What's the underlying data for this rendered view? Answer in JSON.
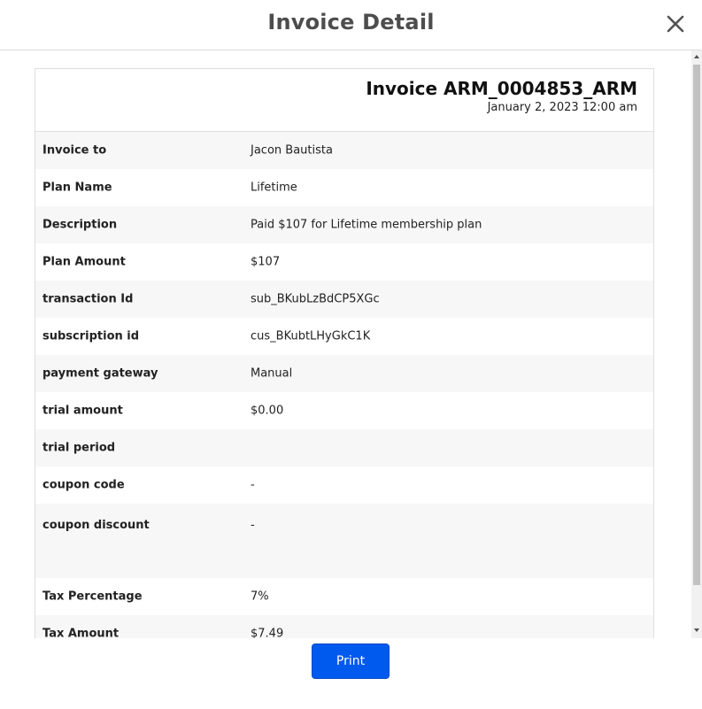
{
  "modal": {
    "title": "Invoice Detail",
    "close_icon": "close-icon"
  },
  "invoice": {
    "number": "Invoice ARM_0004853_ARM",
    "date": "January 2, 2023 12:00 am"
  },
  "rows": [
    {
      "label": "Invoice to",
      "value": "Jacon Bautista"
    },
    {
      "label": "Plan Name",
      "value": "Lifetime"
    },
    {
      "label": "Description",
      "value": "Paid $107 for Lifetime membership plan"
    },
    {
      "label": "Plan Amount",
      "value": "$107"
    },
    {
      "label": "transaction Id",
      "value": "sub_BKubLzBdCP5XGc"
    },
    {
      "label": "subscription id",
      "value": "cus_BKubtLHyGkC1K"
    },
    {
      "label": "payment gateway",
      "value": "Manual"
    },
    {
      "label": "trial amount",
      "value": "$0.00"
    },
    {
      "label": "trial period",
      "value": ""
    },
    {
      "label": "coupon code",
      "value": "-"
    },
    {
      "label": "coupon discount",
      "value": "-"
    },
    {
      "label": "Tax Percentage",
      "value": "7%"
    },
    {
      "label": "Tax Amount",
      "value": "$7.49"
    }
  ],
  "footer": {
    "print_label": "Print"
  }
}
